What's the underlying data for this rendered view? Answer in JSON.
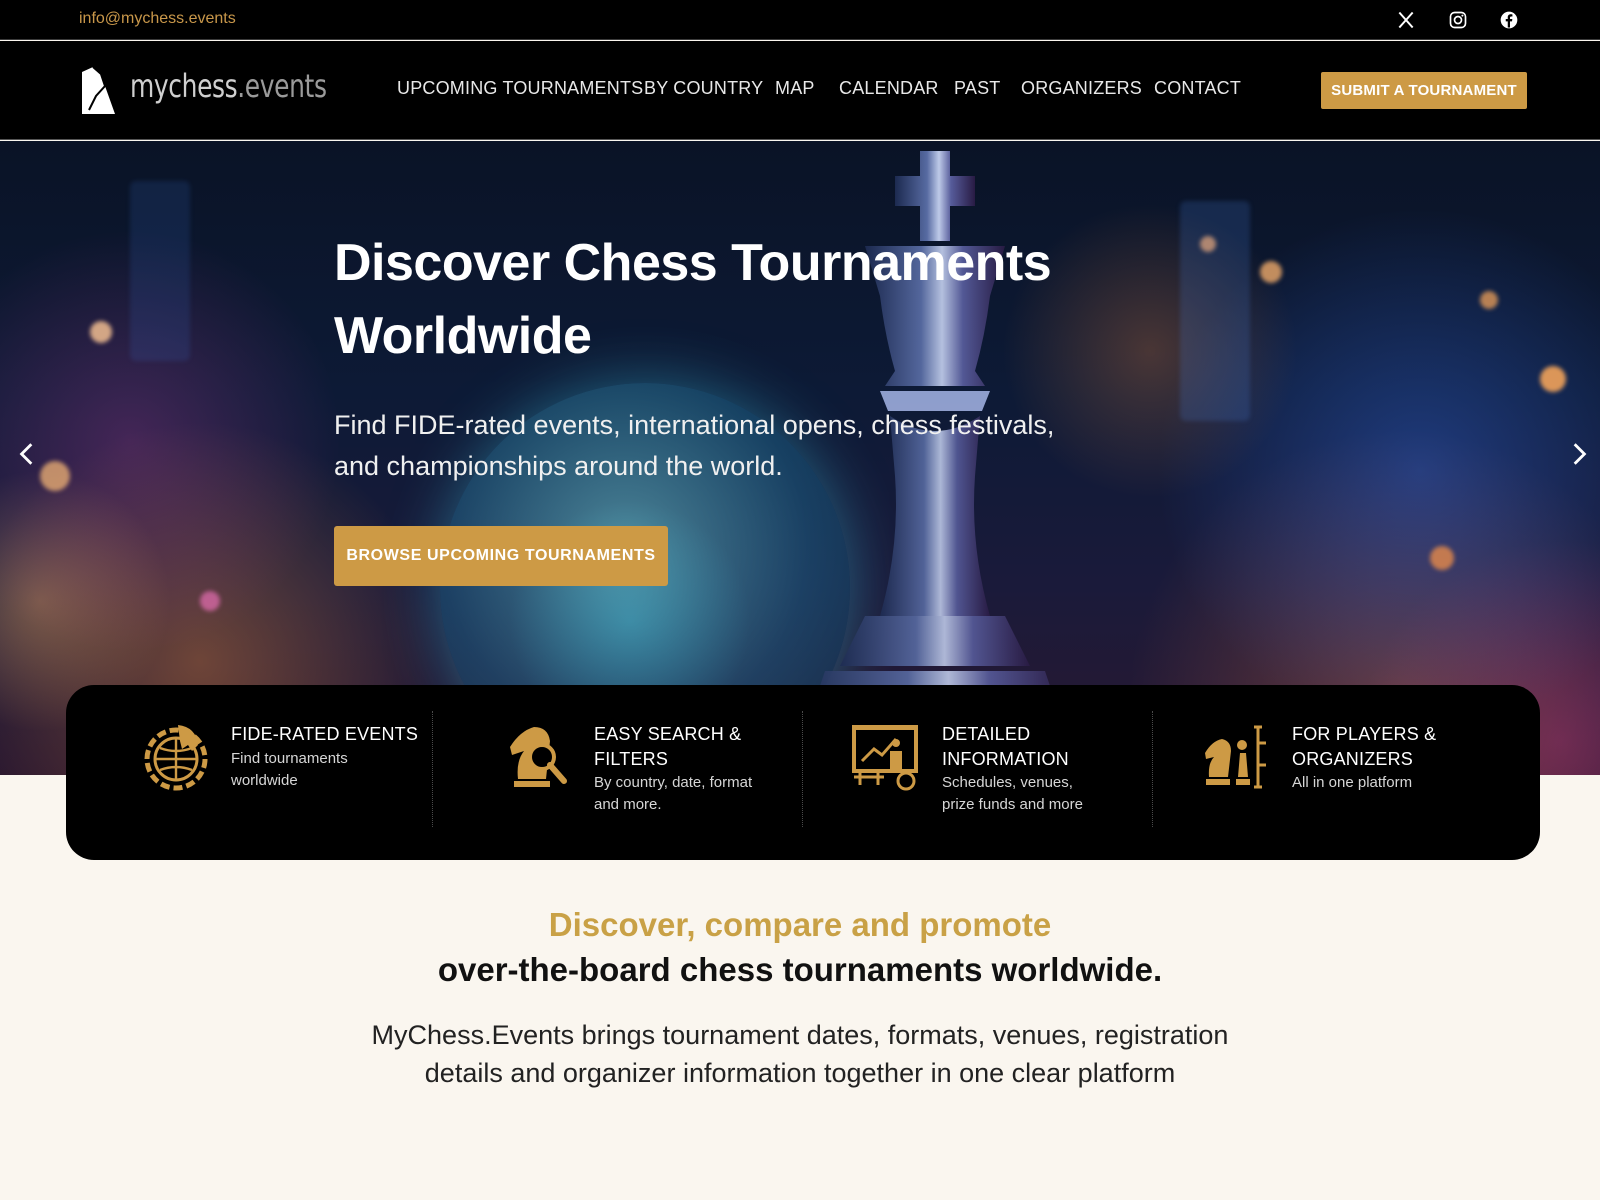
{
  "topbar": {
    "email": "info@mychess.events",
    "social": [
      "x-icon",
      "instagram-icon",
      "facebook-icon"
    ]
  },
  "nav": {
    "logo": {
      "name": "mychess",
      "tld": ".events"
    },
    "menu": [
      "UPCOMING TOURNAMENTS",
      "BY COUNTRY",
      "MAP",
      "CALENDAR",
      "PAST",
      "ORGANIZERS",
      "CONTACT"
    ],
    "submit_label": "SUBMIT A TOURNAMENT"
  },
  "hero": {
    "title": "Discover Chess Tournaments Worldwide",
    "subtitle": "Find FIDE-rated events, international opens, chess festivals, and championships around the world.",
    "cta_label": "BROWSE UPCOMING TOURNAMENTS"
  },
  "features": [
    {
      "icon": "globe-knight-icon",
      "title": "FIDE-RATED EVENTS",
      "desc": "Find tournaments worldwide"
    },
    {
      "icon": "knight-search-icon",
      "title": "EASY SEARCH & FILTERS",
      "desc": "By country, date, format and more."
    },
    {
      "icon": "presentation-chart-icon",
      "title": "DETAILED INFORMATION",
      "desc": "Schedules, venues, prize funds and more"
    },
    {
      "icon": "chess-pieces-network-icon",
      "title": "FOR PLAYERS & ORGANIZERS",
      "desc": "All in one platform"
    }
  ],
  "intro": {
    "tagline_line1": "Discover, compare and promote",
    "tagline_line2": "over-the-board chess tournaments worldwide.",
    "body": "MyChess.Events brings tournament dates, formats, venues, registration details and organizer information together in one clear platform"
  },
  "colors": {
    "accent": "#cd9a45",
    "tagline_gold": "#c9a146",
    "nav_bg": "#000000",
    "page_bg": "#faf6ef"
  }
}
